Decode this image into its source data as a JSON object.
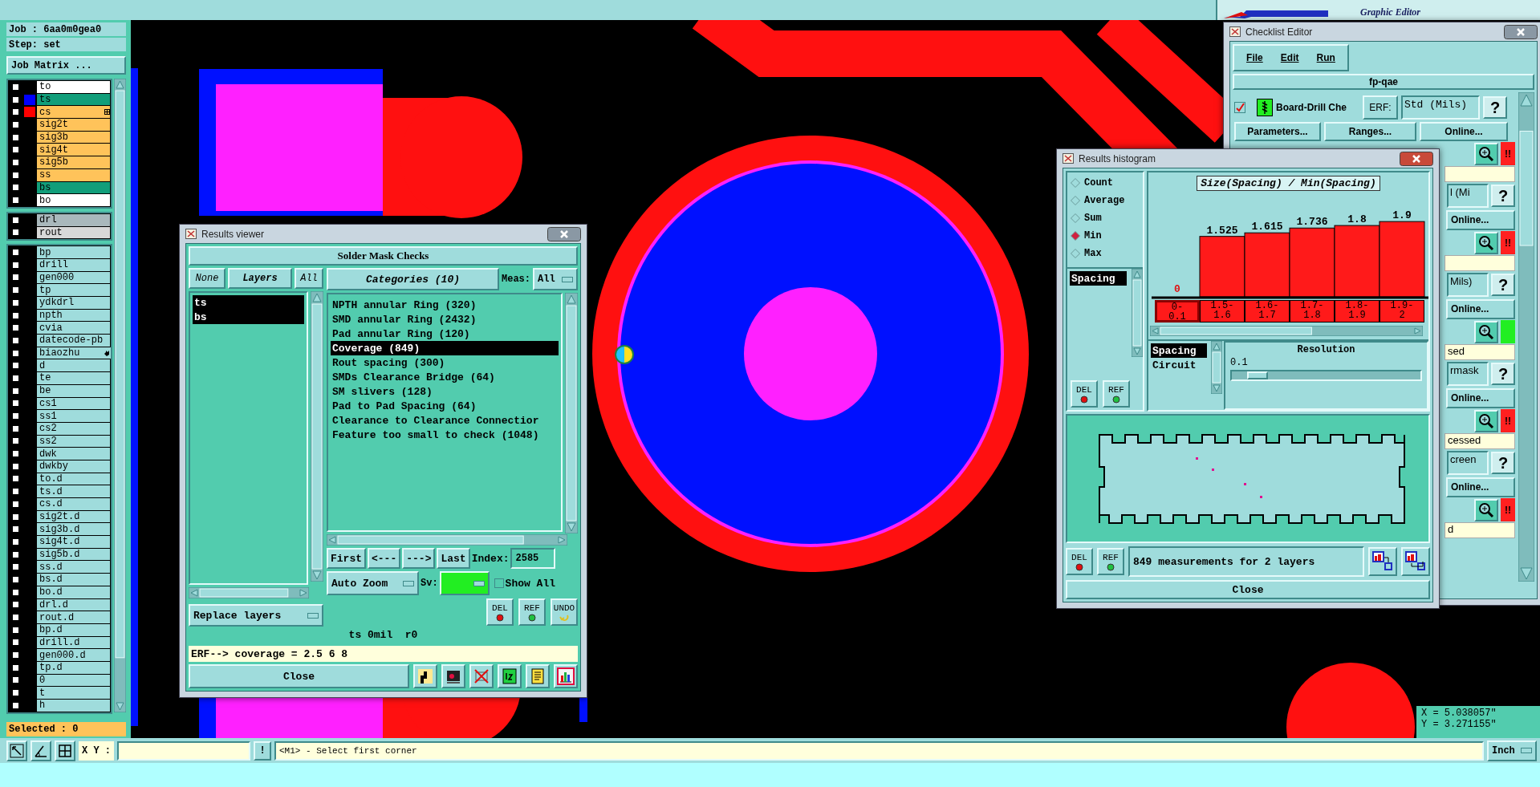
{
  "menu_bar": {
    "logo_subtitle": "Graphic Editor"
  },
  "layer_panel": {
    "job": "Job : 6aa0m0gea0",
    "step": "Step: set",
    "job_matrix_button": "Job Matrix ...",
    "selected_count": "Selected : 0",
    "groups": [
      [
        {
          "name": "to",
          "checked": false,
          "kind": "silk"
        },
        {
          "name": "ts",
          "checked": false,
          "kind": "mask",
          "color": "#0000ff"
        },
        {
          "name": "cs",
          "checked": false,
          "kind": "signal",
          "color": "#ff0000",
          "grid_mark": true
        },
        {
          "name": "sig2t",
          "checked": false,
          "kind": "signal"
        },
        {
          "name": "sig3b",
          "checked": false,
          "kind": "signal"
        },
        {
          "name": "sig4t",
          "checked": false,
          "kind": "signal"
        },
        {
          "name": "sig5b",
          "checked": false,
          "kind": "signal"
        },
        {
          "name": "ss",
          "checked": false,
          "kind": "signal"
        },
        {
          "name": "bs",
          "checked": false,
          "kind": "mask"
        },
        {
          "name": "bo",
          "checked": false,
          "kind": "silk"
        }
      ],
      [
        {
          "name": "drl",
          "checked": false,
          "kind": "drill"
        },
        {
          "name": "rout",
          "checked": false,
          "kind": "rout"
        }
      ],
      [
        {
          "name": "bp",
          "checked": false,
          "kind": "plain"
        },
        {
          "name": "drill",
          "checked": false,
          "kind": "plain"
        },
        {
          "name": "gen000",
          "checked": false,
          "kind": "plain"
        },
        {
          "name": "tp",
          "checked": false,
          "kind": "plain"
        },
        {
          "name": "ydkdrl",
          "checked": false,
          "kind": "plain"
        },
        {
          "name": "npth",
          "checked": false,
          "kind": "plain"
        },
        {
          "name": "cvia",
          "checked": false,
          "kind": "plain"
        },
        {
          "name": "datecode-pb",
          "checked": false,
          "kind": "plain"
        },
        {
          "name": "biaozhu",
          "checked": false,
          "kind": "plain",
          "hand_mark": true
        },
        {
          "name": "d",
          "checked": false,
          "kind": "plain"
        },
        {
          "name": "te",
          "checked": false,
          "kind": "plain"
        },
        {
          "name": "be",
          "checked": false,
          "kind": "plain"
        },
        {
          "name": "cs1",
          "checked": false,
          "kind": "plain"
        },
        {
          "name": "ss1",
          "checked": false,
          "kind": "plain"
        },
        {
          "name": "cs2",
          "checked": false,
          "kind": "plain"
        },
        {
          "name": "ss2",
          "checked": false,
          "kind": "plain"
        },
        {
          "name": "dwk",
          "checked": false,
          "kind": "plain"
        },
        {
          "name": "dwkby",
          "checked": false,
          "kind": "plain"
        },
        {
          "name": "to.d",
          "checked": false,
          "kind": "plain"
        },
        {
          "name": "ts.d",
          "checked": false,
          "kind": "plain"
        },
        {
          "name": "cs.d",
          "checked": false,
          "kind": "plain"
        },
        {
          "name": "sig2t.d",
          "checked": false,
          "kind": "plain"
        },
        {
          "name": "sig3b.d",
          "checked": false,
          "kind": "plain"
        },
        {
          "name": "sig4t.d",
          "checked": false,
          "kind": "plain"
        },
        {
          "name": "sig5b.d",
          "checked": false,
          "kind": "plain"
        },
        {
          "name": "ss.d",
          "checked": false,
          "kind": "plain"
        },
        {
          "name": "bs.d",
          "checked": false,
          "kind": "plain"
        },
        {
          "name": "bo.d",
          "checked": false,
          "kind": "plain"
        },
        {
          "name": "drl.d",
          "checked": false,
          "kind": "plain"
        },
        {
          "name": "rout.d",
          "checked": false,
          "kind": "plain"
        },
        {
          "name": "bp.d",
          "checked": false,
          "kind": "plain"
        },
        {
          "name": "drill.d",
          "checked": false,
          "kind": "plain"
        },
        {
          "name": "gen000.d",
          "checked": false,
          "kind": "plain"
        },
        {
          "name": "tp.d",
          "checked": false,
          "kind": "plain"
        },
        {
          "name": "0",
          "checked": false,
          "kind": "plain"
        },
        {
          "name": "t",
          "checked": false,
          "kind": "plain"
        },
        {
          "name": "h",
          "checked": false,
          "kind": "plain"
        }
      ]
    ]
  },
  "results_viewer": {
    "title": "Results viewer",
    "header": "Solder Mask Checks",
    "none_button": "None",
    "layers_label": "Layers",
    "all_button": "All",
    "layers": [
      {
        "label": "ts",
        "selected": true
      },
      {
        "label": "bs",
        "selected": true
      }
    ],
    "replace_dropdown": "Replace layers",
    "categories_label": "Categories (10)",
    "meas_label": "Meas:",
    "meas_dropdown": "All",
    "categories": [
      {
        "label": "NPTH annular Ring (320)",
        "selected": false
      },
      {
        "label": "SMD annular Ring (2432)",
        "selected": false
      },
      {
        "label": "Pad annular Ring (120)",
        "selected": false
      },
      {
        "label": "Coverage (849)",
        "selected": true
      },
      {
        "label": "Rout spacing (300)",
        "selected": false
      },
      {
        "label": "SMDs Clearance Bridge (64)",
        "selected": false
      },
      {
        "label": "SM slivers (128)",
        "selected": false
      },
      {
        "label": "Pad to Pad Spacing (64)",
        "selected": false
      },
      {
        "label": "Clearance to Clearance Connectior",
        "selected": false
      },
      {
        "label": "Feature too small to check (1048)",
        "selected": false
      }
    ],
    "nav_buttons": [
      "First",
      "<---",
      "--->",
      "Last"
    ],
    "index_label": "Index:",
    "index_value": "2585",
    "zoom_dropdown": "Auto Zoom",
    "sv_label": "Sv:",
    "show_all": {
      "label": "Show All",
      "checked": false
    },
    "action_buttons": [
      "DEL",
      "REF",
      "UNDO"
    ],
    "info": "ts 0mil  r0",
    "erf_line": "ERF--> coverage = 2.5 6 8",
    "close_button": "Close"
  },
  "checklist_editor": {
    "title": "Checklist Editor",
    "menus": [
      "File",
      "Edit",
      "Run"
    ],
    "name": "fp-qae",
    "check": {
      "checked": true,
      "label": "Board-Drill Che",
      "erf_button": "ERF:",
      "erf_value": "Std (Mils)",
      "help": "?"
    },
    "buttons": [
      "Parameters...",
      "Ranges...",
      "Online..."
    ],
    "rows": [
      {
        "kind": "status",
        "color": "#ff2020",
        "flag": "!!"
      },
      {
        "kind": "note"
      },
      {
        "kind": "erf",
        "text": "l (Mi",
        "help": "?"
      },
      {
        "kind": "online",
        "text": "Online..."
      },
      {
        "kind": "status",
        "color": "#ff2020",
        "flag": "!!"
      },
      {
        "kind": "note"
      },
      {
        "kind": "erf",
        "text": "Mils)",
        "help": "?"
      },
      {
        "kind": "online",
        "text": "Online..."
      },
      {
        "kind": "status",
        "color": "#22ee22"
      },
      {
        "kind": "note",
        "text": "sed"
      },
      {
        "kind": "erf",
        "text": "rmask",
        "help": "?"
      },
      {
        "kind": "online",
        "text": "Online..."
      },
      {
        "kind": "status",
        "color": "#ff2020",
        "flag": "!!"
      },
      {
        "kind": "note",
        "text": "cessed"
      },
      {
        "kind": "erf",
        "text": "creen",
        "help": "?"
      },
      {
        "kind": "online",
        "text": "Online..."
      },
      {
        "kind": "status",
        "color": "#ff2020",
        "flag": "!!"
      },
      {
        "kind": "note",
        "text": "d"
      }
    ]
  },
  "results_histogram": {
    "title": "Results histogram",
    "functions": [
      {
        "label": "Count",
        "selected": false
      },
      {
        "label": "Average",
        "selected": false
      },
      {
        "label": "Sum",
        "selected": false
      },
      {
        "label": "Min",
        "selected": true
      },
      {
        "label": "Max",
        "selected": false
      }
    ],
    "measures": [
      {
        "label": "Spacing",
        "selected": true
      }
    ],
    "side_buttons": [
      "DEL",
      "REF"
    ],
    "chart_data": {
      "type": "bar",
      "title": "Size(Spacing) / Min(Spacing)",
      "categories": [
        "0-0.1",
        "1.5-1.6",
        "1.6-1.7",
        "1.7-1.8",
        "1.8-1.9",
        "1.9-2"
      ],
      "values": [
        0,
        1.525,
        1.615,
        1.736,
        1.8,
        1.9
      ],
      "data_labels": true
    },
    "bins": [
      {
        "selected": true
      },
      {
        "selected": false
      },
      {
        "selected": false
      },
      {
        "selected": false
      },
      {
        "selected": false
      },
      {
        "selected": false
      }
    ],
    "types": [
      {
        "label": "Spacing",
        "selected": true
      },
      {
        "label": "Circuit",
        "selected": false
      }
    ],
    "resolution": {
      "label": "Resolution",
      "value": "0.1",
      "level": 0.08
    },
    "footer_buttons": [
      "DEL",
      "REF"
    ],
    "status": "849 measurements for 2 layers",
    "close_button": "Close"
  },
  "coordinates": {
    "x": "X = 5.038057\"",
    "y": "Y = 3.271155\""
  },
  "command_bar": {
    "xy_label": "X Y :",
    "bang_button": "!",
    "prompt": "<M1> - Select first corner",
    "units_dropdown": "Inch"
  }
}
